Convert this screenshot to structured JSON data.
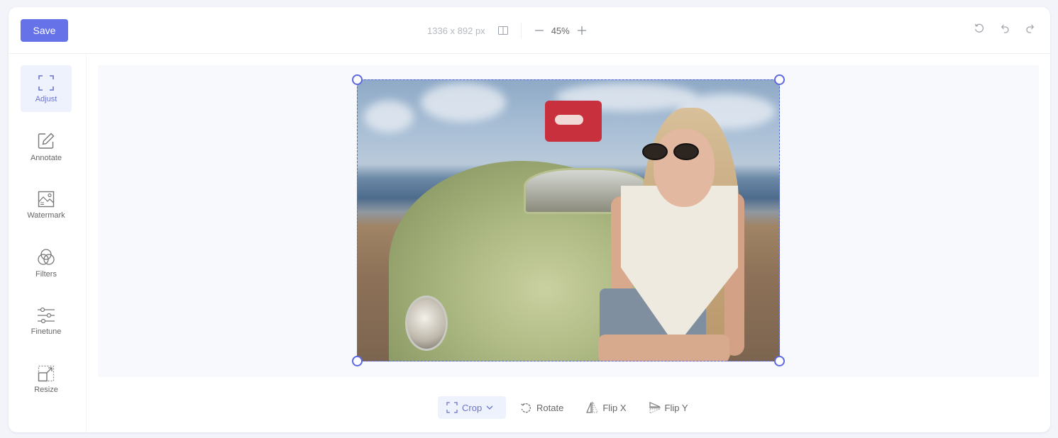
{
  "toolbar": {
    "save_label": "Save",
    "image_dimensions": "1336 x 892 px",
    "compare_icon": "split-view-icon",
    "zoom_out_icon": "minus-icon",
    "zoom_level": "45%",
    "zoom_in_icon": "plus-icon",
    "history": [
      {
        "name": "reset",
        "icon": "reset-icon"
      },
      {
        "name": "undo",
        "icon": "undo-icon"
      },
      {
        "name": "redo",
        "icon": "redo-icon"
      }
    ]
  },
  "sidebar": {
    "items": [
      {
        "label": "Adjust",
        "icon": "crop-frame-icon",
        "active": true
      },
      {
        "label": "Annotate",
        "icon": "pencil-icon",
        "active": false
      },
      {
        "label": "Watermark",
        "icon": "image-watermark-icon",
        "active": false
      },
      {
        "label": "Filters",
        "icon": "filters-circles-icon",
        "active": false
      },
      {
        "label": "Finetune",
        "icon": "sliders-icon",
        "active": false
      },
      {
        "label": "Resize",
        "icon": "resize-icon",
        "active": false
      }
    ]
  },
  "canvas": {
    "image_description": "Woman in sunglasses and white top sitting on green vintage car at beach"
  },
  "bottom_tools": {
    "items": [
      {
        "label": "Crop",
        "icon": "crop-icon",
        "has_dropdown": true,
        "active": true
      },
      {
        "label": "Rotate",
        "icon": "rotate-icon",
        "active": false
      },
      {
        "label": "Flip X",
        "icon": "flip-x-icon",
        "active": false
      },
      {
        "label": "Flip Y",
        "icon": "flip-y-icon",
        "active": false
      }
    ]
  },
  "colors": {
    "accent": "#6672e8",
    "crop_border": "#5c68e0",
    "active_bg": "#eef2fd",
    "canvas_bg": "#f7f9fc"
  }
}
